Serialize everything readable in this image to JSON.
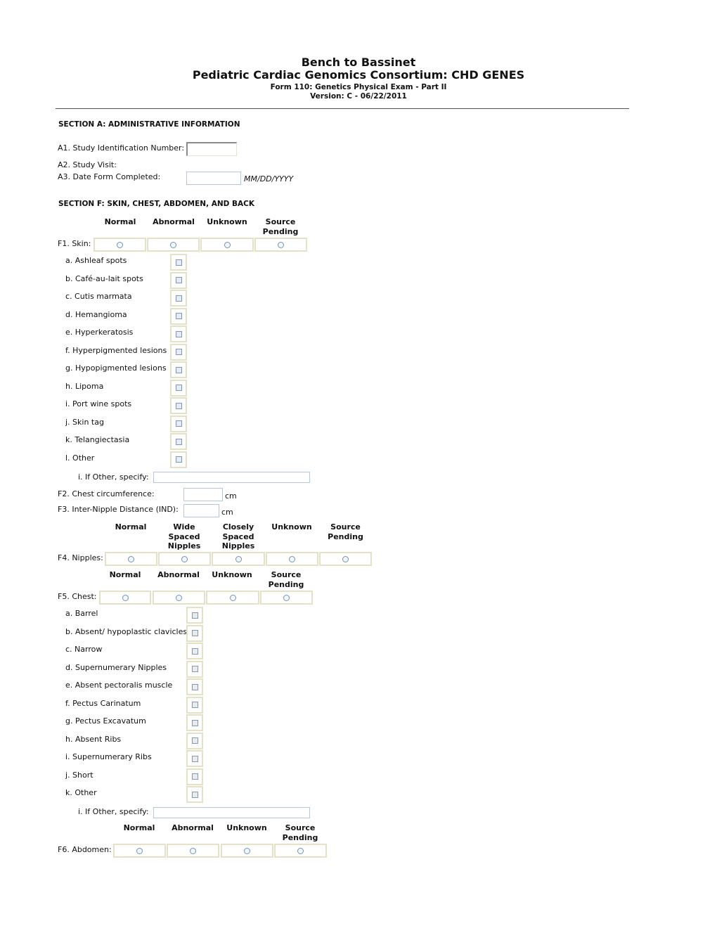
{
  "header": {
    "title": "Bench to Bassinet",
    "subtitle": "Pediatric Cardiac Genomics Consortium: CHD GENES",
    "form": "Form 110: Genetics Physical Exam - Part II",
    "version": "Version: C - 06/22/2011"
  },
  "section_a": {
    "heading": "SECTION A: ADMINISTRATIVE INFORMATION",
    "a1_label": "A1. Study Identification Number:",
    "a1_value": "",
    "a2_label": "A2. Study Visit:",
    "a3_label": "A3. Date Form Completed:",
    "a3_value": "",
    "a3_hint": "MM/DD/YYYY"
  },
  "section_f": {
    "heading": "SECTION F: SKIN, CHEST, ABDOMEN, AND BACK",
    "f1": {
      "label": "F1. Skin:",
      "options": [
        "Normal",
        "Abnormal",
        "Unknown",
        "Source Pending"
      ],
      "items": [
        "a. Ashleaf spots",
        "b. Café-au-lait spots",
        "c. Cutis marmata",
        "d. Hemangioma",
        "e. Hyperkeratosis",
        "f. Hyperpigmented lesions",
        "g. Hypopigmented lesions",
        "h. Lipoma",
        "i. Port wine spots",
        "j. Skin tag",
        "k. Telangiectasia",
        "l. Other"
      ],
      "other_label": "i. If Other, specify:",
      "other_value": ""
    },
    "f2": {
      "label": "F2. Chest circumference:",
      "value": "",
      "unit": "cm"
    },
    "f3": {
      "label": "F3. Inter-Nipple Distance (IND):",
      "value": "",
      "unit": "cm"
    },
    "f4": {
      "label": "F4. Nipples:",
      "options": [
        "Normal",
        "Wide Spaced Nipples",
        "Closely Spaced Nipples",
        "Unknown",
        "Source Pending"
      ]
    },
    "f5": {
      "label": "F5. Chest:",
      "options": [
        "Normal",
        "Abnormal",
        "Unknown",
        "Source Pending"
      ],
      "items": [
        "a. Barrel",
        "b. Absent/ hypoplastic clavicles",
        "c. Narrow",
        "d. Supernumerary Nipples",
        "e. Absent pectoralis muscle",
        "f. Pectus Carinatum",
        "g. Pectus Excavatum",
        "h. Absent Ribs",
        "i. Supernumerary Ribs",
        "j. Short",
        "k. Other"
      ],
      "other_label": "i. If Other, specify:",
      "other_value": ""
    },
    "f6": {
      "label": "F6. Abdomen:",
      "options": [
        "Normal",
        "Abnormal",
        "Unknown",
        "Source Pending"
      ]
    }
  }
}
